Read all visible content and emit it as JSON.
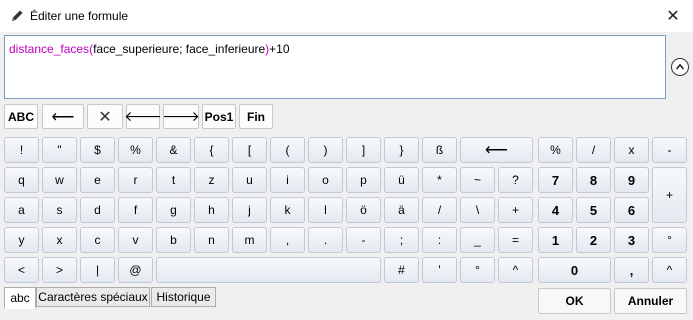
{
  "window": {
    "title": "Éditer une formule",
    "close_glyph": "✕",
    "icon": "pencil-icon"
  },
  "editor": {
    "function_name": "distance_faces",
    "open_paren": "(",
    "args": "face_superieure; face_inferieure",
    "close_paren": ")",
    "suffix": "+10",
    "function_color": "#c000c0"
  },
  "toolbar": {
    "abc": "ABC",
    "backspace": "⟵",
    "clear": "✕",
    "left": "🡐",
    "right": "🡒",
    "pos1": "Pos1",
    "fin": "Fin"
  },
  "keys": {
    "row1": [
      "!",
      "\"",
      "$",
      "%",
      "&",
      "{",
      "[",
      "(",
      ")",
      "]",
      "}",
      "ß",
      "⟵"
    ],
    "row2": [
      "q",
      "w",
      "e",
      "r",
      "t",
      "z",
      "u",
      "i",
      "o",
      "p",
      "ü",
      "*",
      "~",
      "?"
    ],
    "row3": [
      "a",
      "s",
      "d",
      "f",
      "g",
      "h",
      "j",
      "k",
      "l",
      "ö",
      "ä",
      "/",
      "\\",
      "+"
    ],
    "row4": [
      "y",
      "x",
      "c",
      "v",
      "b",
      "n",
      "m",
      ",",
      ".",
      "-",
      ";",
      ":",
      "_",
      "="
    ],
    "row5": [
      "<",
      ">",
      "|",
      "@",
      "#",
      "'",
      "°",
      "^"
    ],
    "num_row1": [
      "%",
      "/",
      "x",
      "-"
    ],
    "num_row2": [
      "7",
      "8",
      "9",
      "+"
    ],
    "num_row3": [
      "4",
      "5",
      "6"
    ],
    "num_row4": [
      "1",
      "2",
      "3",
      "°"
    ],
    "num_row5": [
      "0",
      ",",
      "^"
    ]
  },
  "tabs": [
    "abc",
    "Caractères spéciaux",
    "Historique"
  ],
  "buttons": {
    "ok": "OK",
    "cancel": "Annuler"
  }
}
